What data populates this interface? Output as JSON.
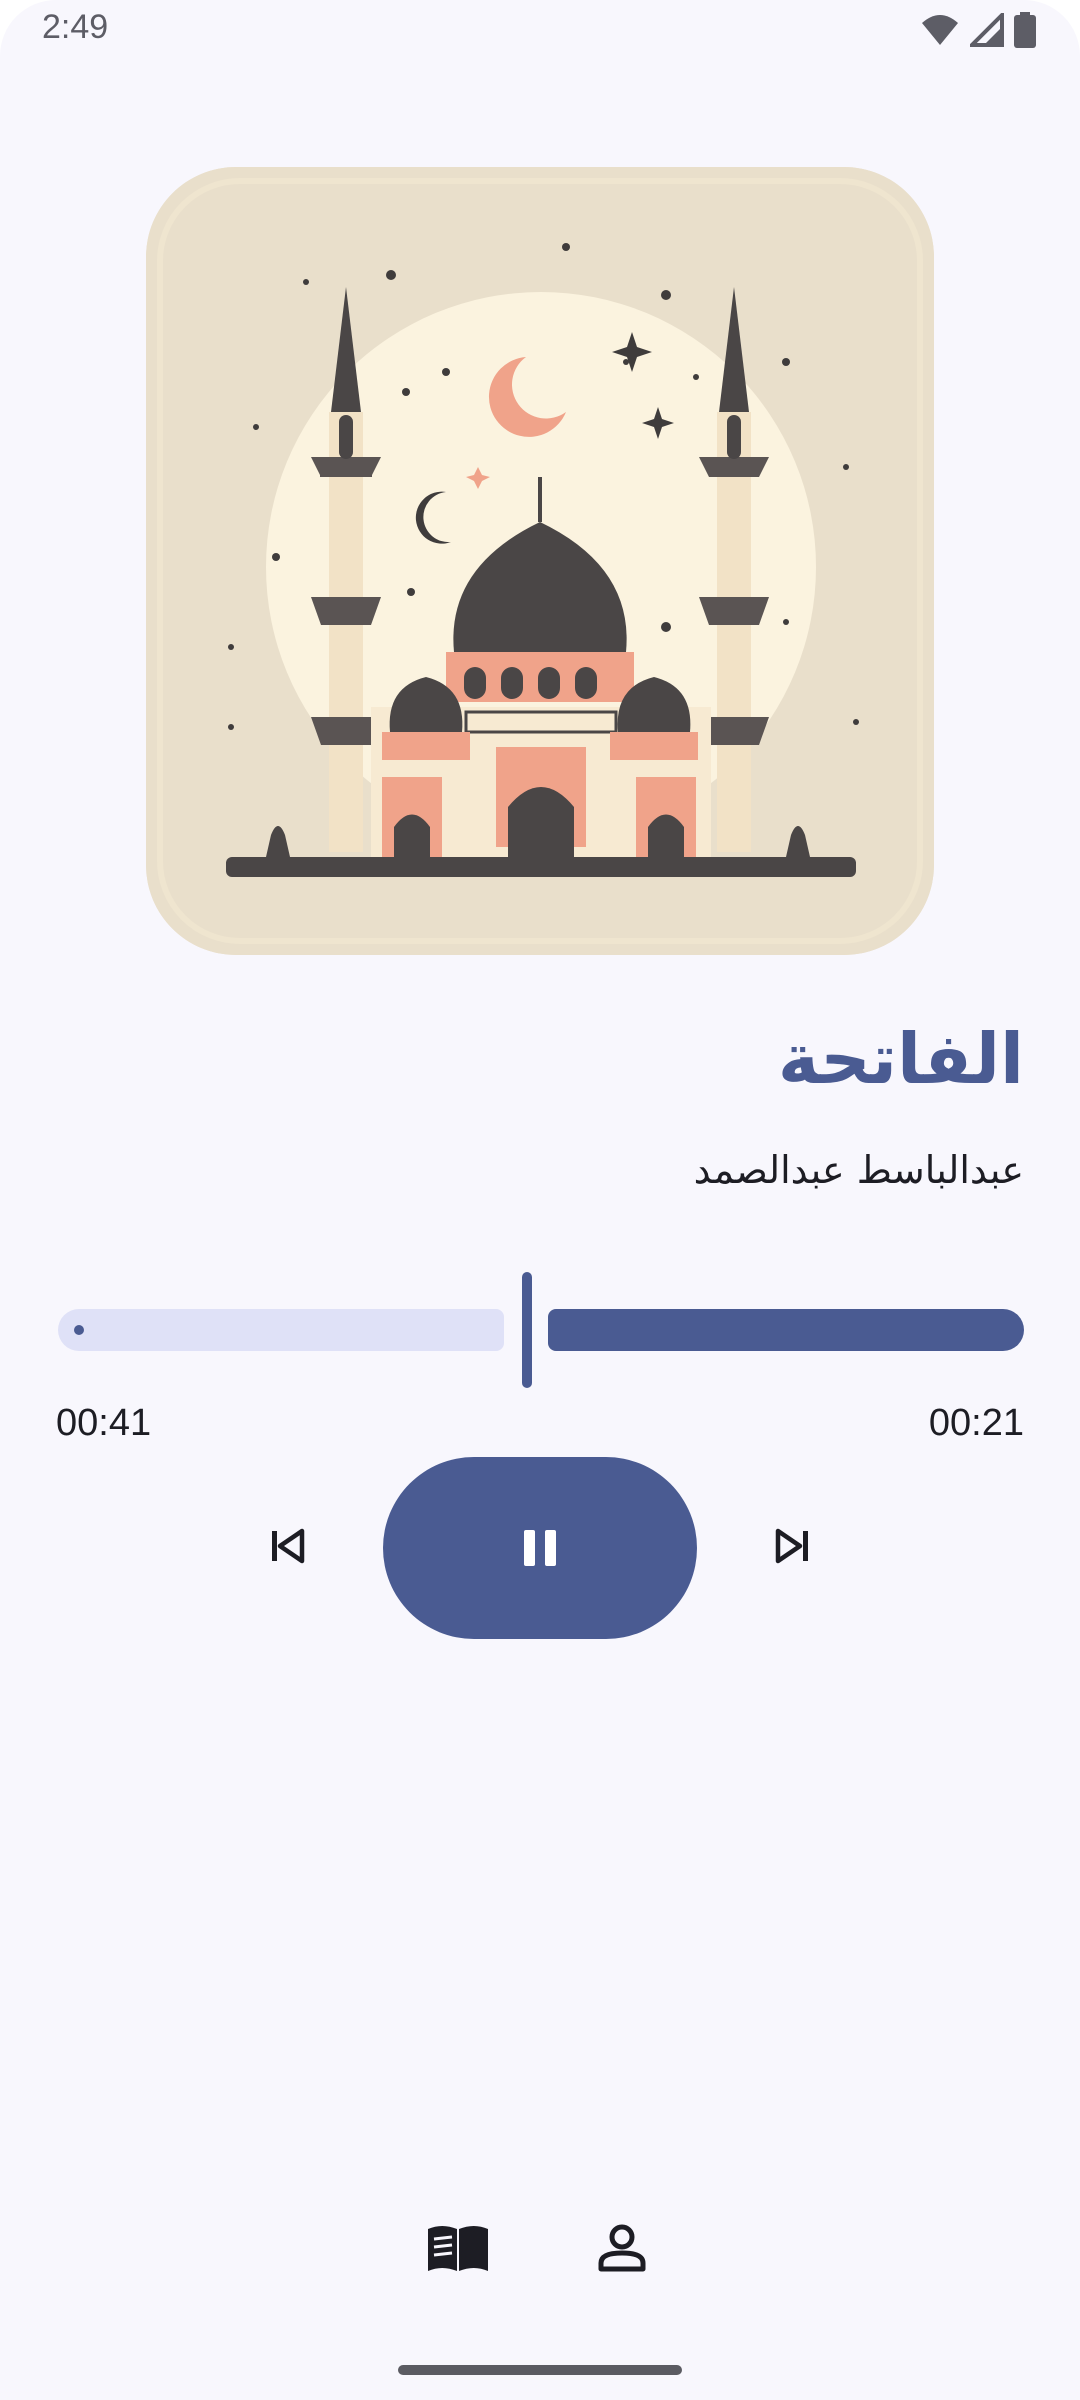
{
  "status_bar": {
    "time": "2:49",
    "icons": [
      "wifi-icon",
      "cellular-signal-icon",
      "battery-icon"
    ]
  },
  "player": {
    "artwork": "mosque-illustration",
    "title": "الفاتحة",
    "reciter": "عبدالباسط عبدالصمد",
    "progress_fraction": 0.48,
    "time_elapsed": "00:41",
    "time_remaining": "00:21",
    "state": "playing"
  },
  "controls": {
    "previous_icon": "skip-previous-icon",
    "play_pause_icon": "pause-icon",
    "next_icon": "skip-next-icon"
  },
  "bottom_nav": {
    "items": [
      {
        "icon": "book-icon"
      },
      {
        "icon": "person-icon"
      }
    ]
  },
  "colors": {
    "primary": "#4a5b92",
    "track_inactive": "#dfe1f7",
    "background": "#f8f7fd",
    "text": "#1d1d24"
  }
}
